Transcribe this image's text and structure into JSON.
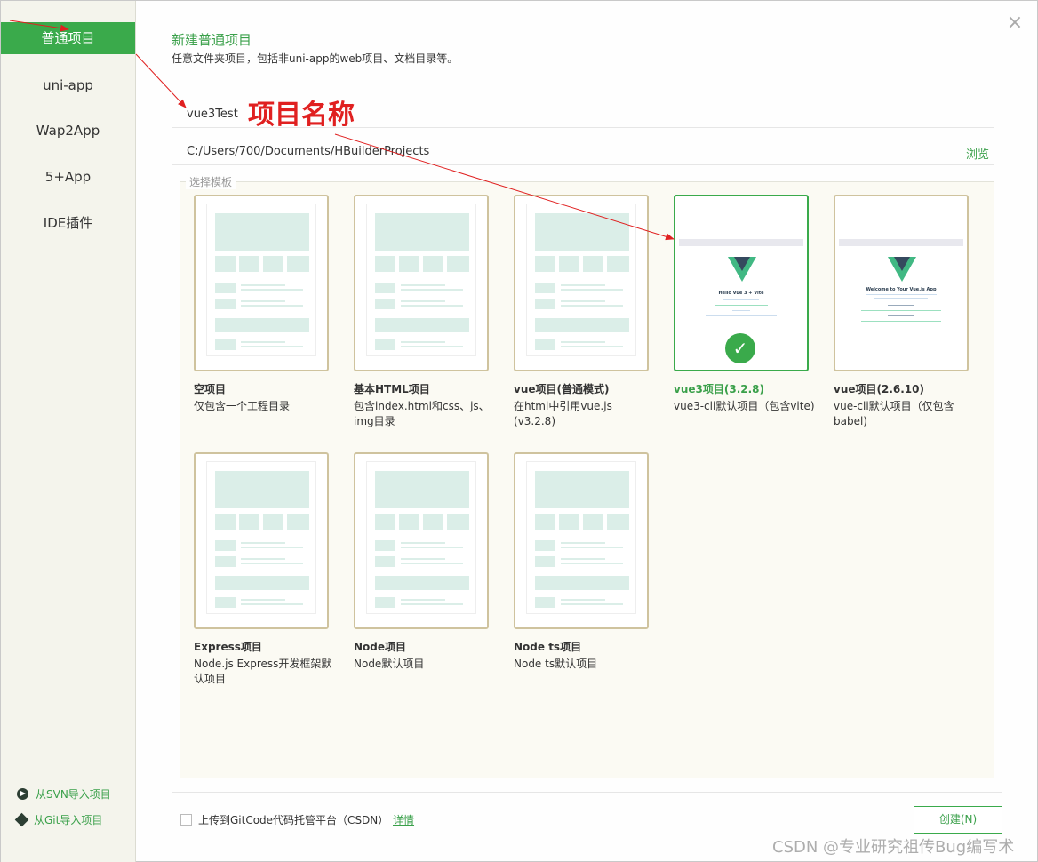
{
  "sidebar": {
    "items": [
      {
        "label": "普通项目",
        "active": true
      },
      {
        "label": "uni-app",
        "active": false
      },
      {
        "label": "Wap2App",
        "active": false
      },
      {
        "label": "5+App",
        "active": false
      },
      {
        "label": "IDE插件",
        "active": false
      }
    ],
    "import_svn": "从SVN导入项目",
    "import_git": "从Git导入项目"
  },
  "header": {
    "title": "新建普通项目",
    "subtitle": "任意文件夹项目，包括非uni-app的web项目、文档目录等。"
  },
  "form": {
    "project_name": "vue3Test",
    "project_path": "C:/Users/700/Documents/HBuilderProjects",
    "browse_label": "浏览"
  },
  "annotation": {
    "name_label": "项目名称"
  },
  "templates": {
    "legend": "选择模板",
    "items": [
      {
        "title": "空项目",
        "desc": "仅包含一个工程目录",
        "selected": false,
        "thumb": "generic"
      },
      {
        "title": "基本HTML项目",
        "desc": "包含index.html和css、js、img目录",
        "selected": false,
        "thumb": "generic"
      },
      {
        "title": "vue项目(普通模式)",
        "desc": "在html中引用vue.js (v3.2.8)",
        "selected": false,
        "thumb": "generic"
      },
      {
        "title": "vue3项目(3.2.8)",
        "desc": "vue3-cli默认项目（包含vite)",
        "selected": true,
        "thumb": "vite"
      },
      {
        "title": "vue项目(2.6.10)",
        "desc": "vue-cli默认项目（仅包含babel)",
        "selected": false,
        "thumb": "vue2"
      },
      {
        "title": "Express项目",
        "desc": "Node.js Express开发框架默认项目",
        "selected": false,
        "thumb": "generic"
      },
      {
        "title": "Node项目",
        "desc": "Node默认项目",
        "selected": false,
        "thumb": "generic"
      },
      {
        "title": "Node ts项目",
        "desc": "Node ts默认项目",
        "selected": false,
        "thumb": "generic"
      }
    ],
    "vite_shot": {
      "heading": "Hello Vue 3 + Vite"
    },
    "vue2_shot": {
      "heading": "Welcome to Your Vue.js App"
    }
  },
  "footer": {
    "upload_label": "上传到GitCode代码托管平台（CSDN）",
    "upload_checked": false,
    "details_label": "详情",
    "create_label": "创建(N)"
  },
  "watermark": "CSDN @专业研究祖传Bug编写术",
  "close_icon": "×",
  "colors": {
    "accent": "#3aaa4b",
    "annotation": "#e02020",
    "card_border": "#cfc39e",
    "sidebar_bg": "#f4f4ec"
  }
}
